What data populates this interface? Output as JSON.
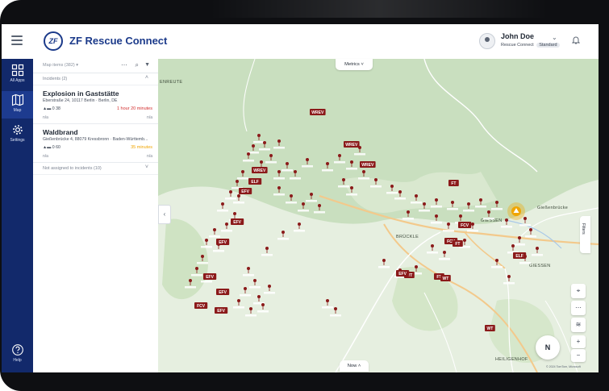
{
  "app": {
    "logo_text": "ZF",
    "title": "ZF Rescue Connect"
  },
  "user": {
    "name": "John Doe",
    "product": "Rescue Connect",
    "plan": "Standard"
  },
  "nav": [
    {
      "label": "All Apps",
      "icon": "grid-icon"
    },
    {
      "label": "Map",
      "icon": "map-icon"
    },
    {
      "label": "Settings",
      "icon": "gear-icon"
    },
    {
      "label": "Help",
      "icon": "help-icon"
    }
  ],
  "panel": {
    "header_label": "Map items (382) ▾",
    "incidents_header": "Incidents (2)",
    "not_assigned": "Not assigned to incidents (10)",
    "incidents": [
      {
        "title": "Explosion in Gaststätte",
        "address": "Eberstraße 24, 10117 Berlin · Berlin, DE",
        "units": "0   38",
        "time": "1 hour 20 minutes",
        "time_color": "#d32f2f",
        "na_left": "n/a",
        "na_right": "n/a"
      },
      {
        "title": "Waldbrand",
        "address": "Gießenbrücke 4, 88079 Kressbronn · Baden-Württemb...",
        "units": "0   60",
        "time": "35 minutes",
        "time_color": "#f0a500",
        "na_left": "n/a",
        "na_right": "n/a"
      }
    ]
  },
  "map": {
    "metrics_label": "Metrics",
    "now_label": "Now",
    "filters_label": "Filters",
    "compass_label": "N",
    "attribution": "© 2024 TomTom, Microsoft",
    "places": [
      "ENREUTE",
      "BRÜCKLE",
      "GIESSEN",
      "GIESSEN",
      "HEILIGENHOF",
      "Gießenbrücke"
    ],
    "marker_color": "#8b1a1a",
    "road_color": "#f3c98b",
    "incident_marker_color": "#f0a500",
    "badges": [
      "WREV",
      "WREV",
      "WREV",
      "WREV",
      "ELF",
      "EFV",
      "EFV",
      "EFV",
      "EFV",
      "EFV",
      "EFV",
      "FCV",
      "WT",
      "WT",
      "FT",
      "FT",
      "FCV",
      "FCV",
      "EFV",
      "FT",
      "WT",
      "ELF"
    ]
  }
}
